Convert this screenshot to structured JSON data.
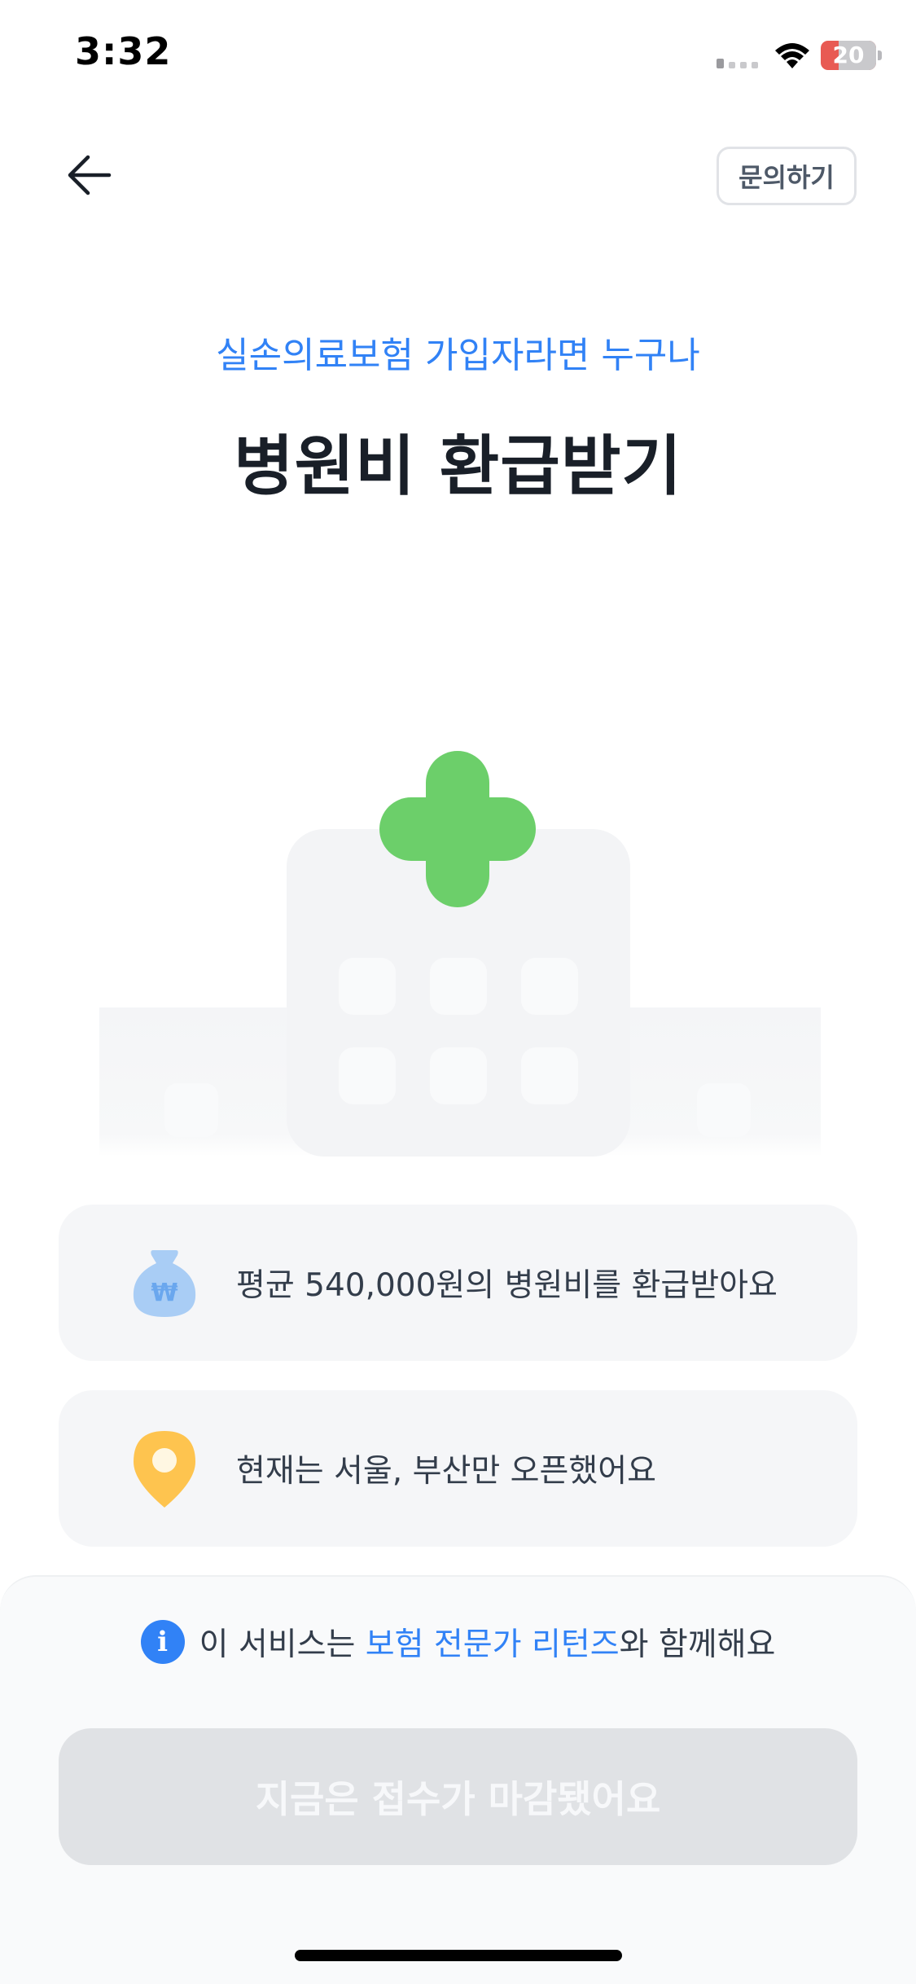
{
  "status_bar": {
    "time": "3:32",
    "battery": "20",
    "battery_color": "#e85a53"
  },
  "nav": {
    "back_icon": "arrow-left-icon",
    "inquiry_label": "문의하기"
  },
  "hero": {
    "subtitle": "실손의료보험 가입자라면 누구나",
    "title": "병원비 환급받기",
    "illustration": "hospital-building-with-green-cross"
  },
  "info_cards": [
    {
      "icon": "money-bag-icon",
      "text": "평균 540,000원의 병원비를 환급받아요"
    },
    {
      "icon": "location-pin-icon",
      "text": "현재는 서울, 부산만 오픈했어요"
    }
  ],
  "notice": {
    "icon": "info-icon",
    "prefix": "이 서비스는 ",
    "highlight": "보험 전문가 리턴즈",
    "suffix": "와 함께해요"
  },
  "cta": {
    "label": "지금은 접수가 마감됐어요",
    "disabled": true
  },
  "colors": {
    "accent": "#3182f6",
    "cross_green": "#6ccf6a",
    "pin_yellow": "#fec44f"
  }
}
